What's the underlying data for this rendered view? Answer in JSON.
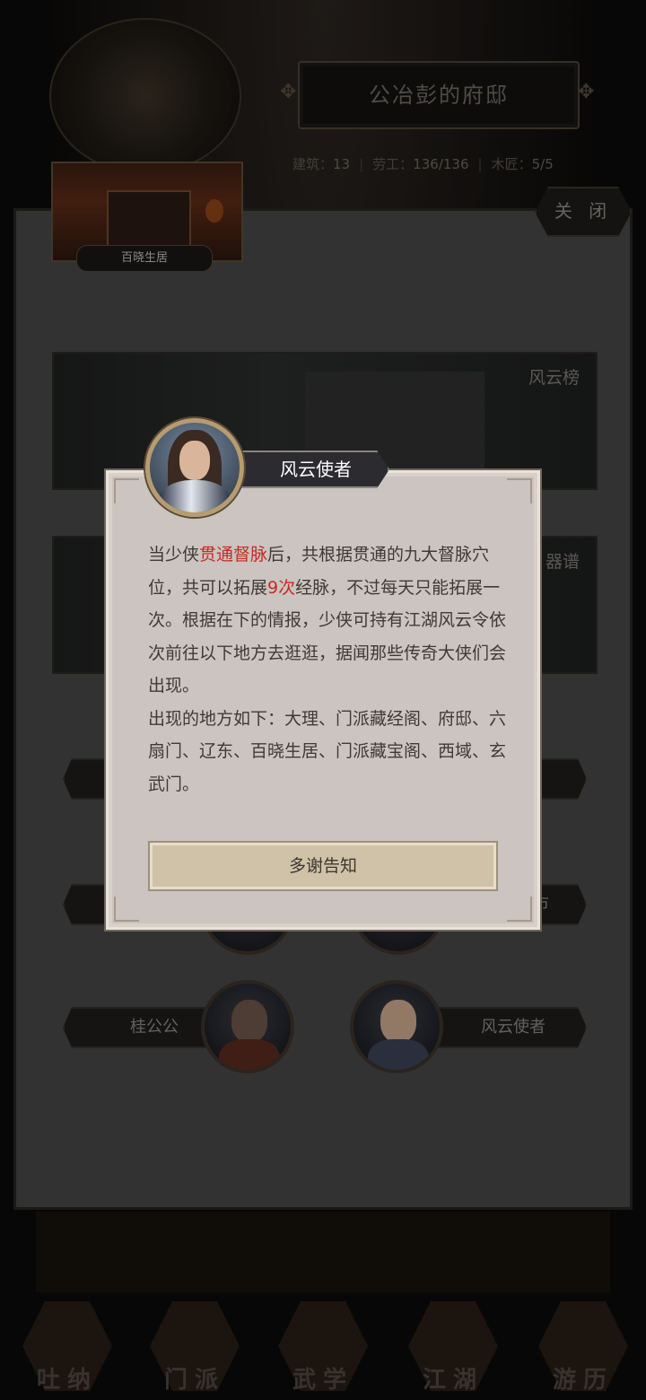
{
  "header": {
    "mansion_title": "公冶彭的府邸",
    "stats": [
      {
        "label": "建筑：",
        "value": "13"
      },
      {
        "label": "劳工：",
        "value": "136/136"
      },
      {
        "label": "木匠：",
        "value": "5/5"
      }
    ],
    "location_label": "百晓生居"
  },
  "panel": {
    "close_label": "关 闭",
    "banners": [
      {
        "title": "风云榜"
      },
      {
        "title": "器谱"
      }
    ],
    "npcs": [
      {
        "name": "桂公公"
      },
      {
        "name": "风云使者"
      }
    ],
    "partial_tag": "市"
  },
  "dialog": {
    "speaker_name": "风云使者",
    "paragraph1": {
      "pre": "当少侠",
      "highlight1": "贯通督脉",
      "mid1": "后，共根据贯通的九大督脉穴位，共可以拓展",
      "highlight2": "9次",
      "post": "经脉，不过每天只能拓展一次。根据在下的情报，少侠可持有江湖风云令依次前往以下地方去逛逛，据闻那些传奇大侠们会出现。"
    },
    "paragraph2": "出现的地方如下：大理、门派藏经阁、府邸、六扇门、辽东、百晓生居、门派藏宝阁、西域、玄武门。",
    "confirm_label": "多谢告知"
  },
  "bottom_nav": {
    "items": [
      {
        "label": "吐纳"
      },
      {
        "label": "门派"
      },
      {
        "label": "武学"
      },
      {
        "label": "江湖"
      },
      {
        "label": "游历"
      }
    ]
  },
  "colors": {
    "highlight": "#c42b25",
    "dialog_bg": "#cbc4c0",
    "panel_bg": "#474646"
  }
}
